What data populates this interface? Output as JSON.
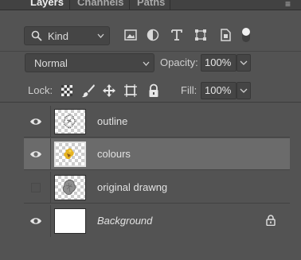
{
  "tabs": {
    "layers": "Layers",
    "channels": "Channels",
    "paths": "Paths"
  },
  "filter": {
    "kind_label": "Kind",
    "icons": [
      "image-filter-icon",
      "adjustment-filter-icon",
      "type-filter-icon",
      "shape-filter-icon",
      "smart-object-filter-icon",
      "filter-toggle-icon"
    ]
  },
  "blend": {
    "mode": "Normal",
    "opacity_label": "Opacity:",
    "opacity_value": "100%"
  },
  "lock": {
    "label": "Lock:",
    "icons": [
      "lock-transparent-pixels-icon",
      "lock-image-pixels-icon",
      "lock-position-icon",
      "lock-artboard-icon",
      "lock-all-icon"
    ],
    "fill_label": "Fill:",
    "fill_value": "100%"
  },
  "layers": [
    {
      "name": "outline",
      "visible": true,
      "selected": false,
      "thumb": "transparent"
    },
    {
      "name": "colours",
      "visible": true,
      "selected": true,
      "thumb": "transparent"
    },
    {
      "name": "original drawng",
      "visible": false,
      "selected": false,
      "thumb": "transparent"
    },
    {
      "name": "Background",
      "visible": true,
      "selected": false,
      "thumb": "white",
      "locked": true
    }
  ],
  "colors": {
    "panel": "#535353",
    "selected_row": "#6b6b6b"
  }
}
